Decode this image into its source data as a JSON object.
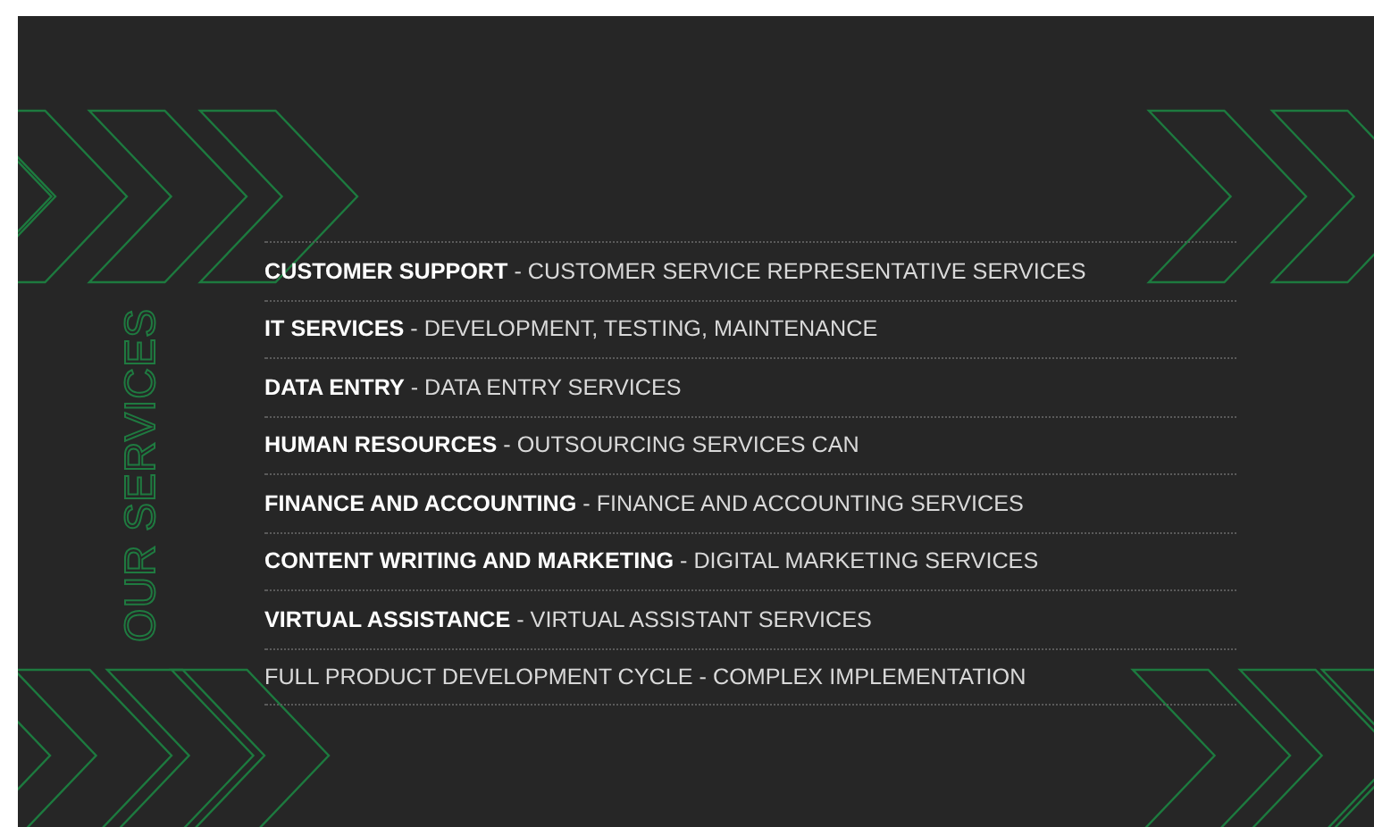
{
  "section": {
    "heading": "OUR SERVICES",
    "services": [
      {
        "text": "**CUSTOMER SUPPORT** - CUSTOMER SERVICE REPRESENTATIVE SERVICES"
      },
      {
        "text": "**IT SERVICES** - DEVELOPMENT, TESTING, MAINTENANCE"
      },
      {
        "text": "**DATA ENTRY** - DATA ENTRY SERVICES"
      },
      {
        "text": "**HUMAN RESOURCES** - OUTSOURCING SERVICES CAN"
      },
      {
        "text": "**FINANCE AND ACCOUNTING** - FINANCE AND ACCOUNTING SERVICES"
      },
      {
        "text": "**CONTENT WRITING AND MARKETING** - DIGITAL MARKETING SERVICES"
      },
      {
        "text": "**VIRTUAL ASSISTANCE** - VIRTUAL ASSISTANT SERVICES"
      },
      {
        "text": "FULL PRODUCT DEVELOPMENT CYCLE - COMPLEX IMPLEMENTATION"
      }
    ]
  }
}
